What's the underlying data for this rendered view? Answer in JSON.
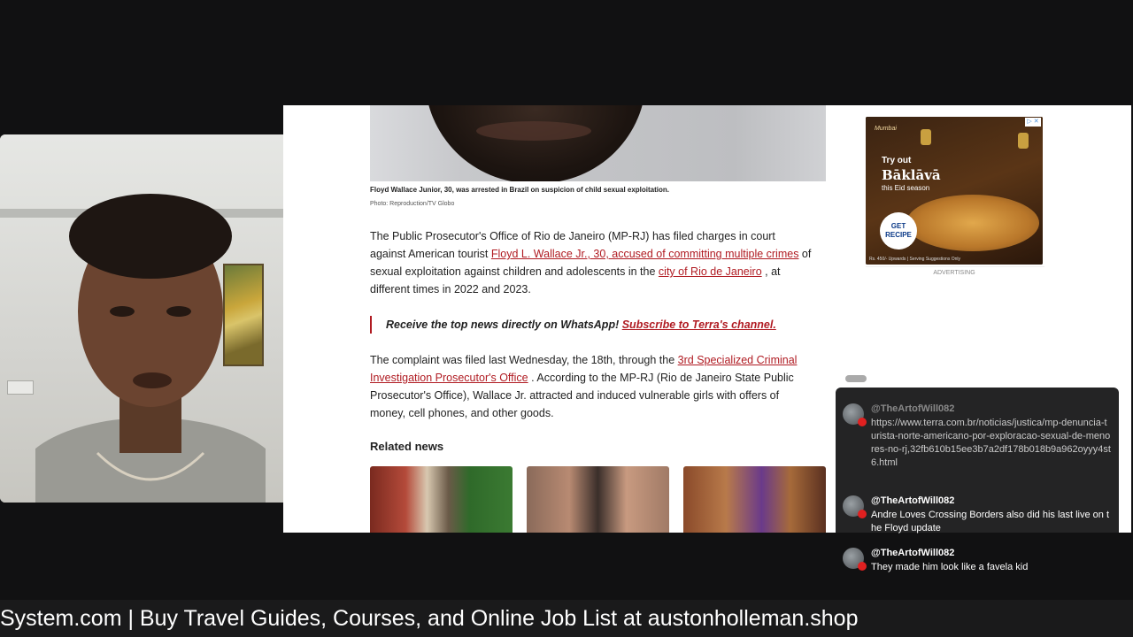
{
  "article": {
    "caption": "Floyd Wallace Junior, 30, was arrested in Brazil on suspicion of child sexual exploitation.",
    "credit": "Photo: Reproduction/TV Globo",
    "p1_t1": "The Public Prosecutor's Office of Rio de Janeiro (MP-RJ) has filed charges in court against American tourist ",
    "p1_link1": "Floyd L. Wallace Jr., 30, accused of committing multiple crimes",
    "p1_t2": " of sexual exploitation against children and adolescents in the ",
    "p1_link2": "city of Rio de Janeiro",
    "p1_t3": " , at different times in 2022 and 2023.",
    "whatsapp_text": "Receive the top news directly on WhatsApp! ",
    "whatsapp_link": "Subscribe to Terra's channel.",
    "p2_t1": "The complaint was filed last Wednesday, the 18th, through the ",
    "p2_link": "3rd Specialized Criminal Investigation Prosecutor's Office",
    "p2_t2": " . According to the MP-RJ (Rio de Janeiro State Public Prosecutor's Office), Wallace Jr. attracted and induced vulnerable girls with offers of money, cell phones, and other goods.",
    "related_title": "Related news"
  },
  "ad": {
    "brand": "Mumbai",
    "line1": "Try out",
    "line2": "Bāklāvā",
    "line3": "this Eid season",
    "cta": "GET RECIPE",
    "fine_print": "Rs. 450/- Upwards | Serving Suggestions Only",
    "close": "▷ ✕",
    "label": "ADVERTISING"
  },
  "chat": {
    "messages": [
      {
        "author": "@TheArtofWill082",
        "text": "https://www.terra.com.br/noticias/justica/mp-denuncia-turista-norte-americano-por-exploracao-sexual-de-menores-no-rj,32fb610b15ee3b7a2df178b018b9a962oyyy4st6.html"
      },
      {
        "author": "@TheArtofWill082",
        "text": "Andre Loves Crossing Borders also did his last live on the Floyd update"
      },
      {
        "author": "@TheArtofWill082",
        "text": "They made him look like a favela kid"
      }
    ]
  },
  "ticker": {
    "text": "System.com | Buy Travel Guides, Courses, and Online Job List at austonholleman.shop"
  },
  "colors": {
    "link": "#b01b22",
    "background": "#111112",
    "chat_badge": "#e02020"
  }
}
